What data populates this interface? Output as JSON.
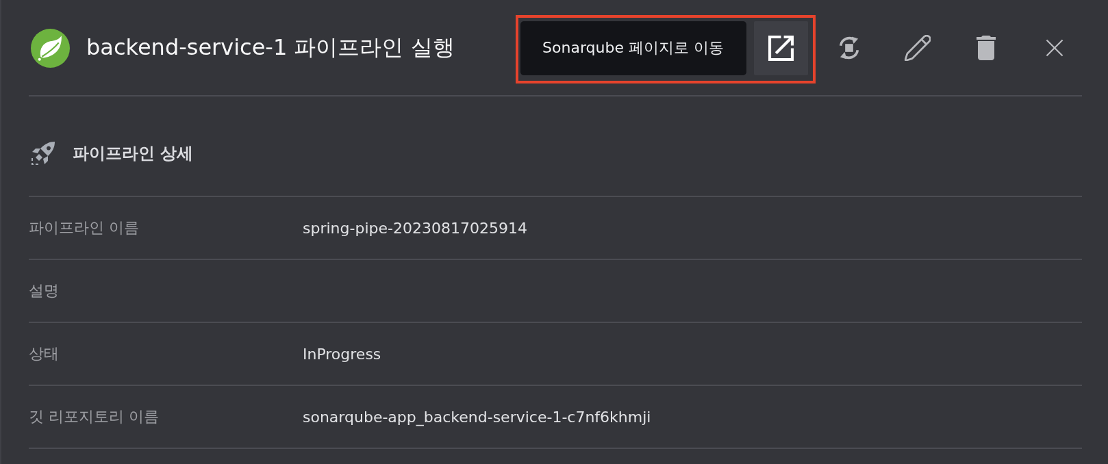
{
  "header": {
    "title": "backend-service-1 파이프라인 실행",
    "actions": [
      {
        "kind": "external-link",
        "hovered": true,
        "highlighted": true,
        "tooltip": "Sonarqube 페이지로 이동"
      },
      {
        "kind": "refresh",
        "hovered": false,
        "highlighted": false
      },
      {
        "kind": "edit",
        "hovered": false,
        "highlighted": false
      },
      {
        "kind": "delete",
        "hovered": false,
        "highlighted": false
      },
      {
        "kind": "close",
        "hovered": false,
        "highlighted": false
      }
    ]
  },
  "section": {
    "title": "파이프라인 상세",
    "rows": [
      {
        "label": "파이프라인 이름",
        "value": "spring-pipe-20230817025914"
      },
      {
        "label": "설명"
      },
      {
        "label": "상태",
        "value": "InProgress"
      },
      {
        "label": "깃 리포지토리 이름",
        "value": "sonarqube-app_backend-service-1-c7nf6khmji"
      }
    ]
  }
}
